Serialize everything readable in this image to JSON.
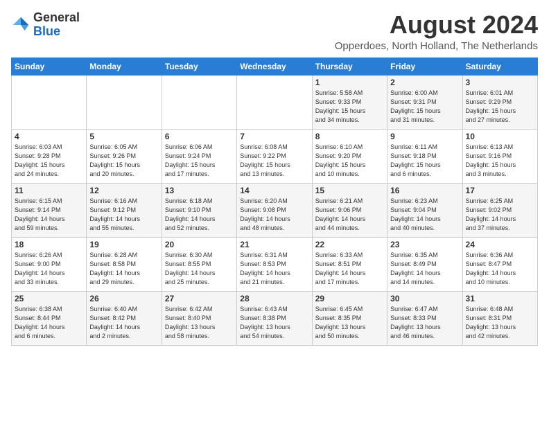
{
  "logo": {
    "general": "General",
    "blue": "Blue"
  },
  "header": {
    "month_title": "August 2024",
    "subtitle": "Opperdoes, North Holland, The Netherlands"
  },
  "days_of_week": [
    "Sunday",
    "Monday",
    "Tuesday",
    "Wednesday",
    "Thursday",
    "Friday",
    "Saturday"
  ],
  "weeks": [
    [
      {
        "day": "",
        "info": ""
      },
      {
        "day": "",
        "info": ""
      },
      {
        "day": "",
        "info": ""
      },
      {
        "day": "",
        "info": ""
      },
      {
        "day": "1",
        "info": "Sunrise: 5:58 AM\nSunset: 9:33 PM\nDaylight: 15 hours\nand 34 minutes."
      },
      {
        "day": "2",
        "info": "Sunrise: 6:00 AM\nSunset: 9:31 PM\nDaylight: 15 hours\nand 31 minutes."
      },
      {
        "day": "3",
        "info": "Sunrise: 6:01 AM\nSunset: 9:29 PM\nDaylight: 15 hours\nand 27 minutes."
      }
    ],
    [
      {
        "day": "4",
        "info": "Sunrise: 6:03 AM\nSunset: 9:28 PM\nDaylight: 15 hours\nand 24 minutes."
      },
      {
        "day": "5",
        "info": "Sunrise: 6:05 AM\nSunset: 9:26 PM\nDaylight: 15 hours\nand 20 minutes."
      },
      {
        "day": "6",
        "info": "Sunrise: 6:06 AM\nSunset: 9:24 PM\nDaylight: 15 hours\nand 17 minutes."
      },
      {
        "day": "7",
        "info": "Sunrise: 6:08 AM\nSunset: 9:22 PM\nDaylight: 15 hours\nand 13 minutes."
      },
      {
        "day": "8",
        "info": "Sunrise: 6:10 AM\nSunset: 9:20 PM\nDaylight: 15 hours\nand 10 minutes."
      },
      {
        "day": "9",
        "info": "Sunrise: 6:11 AM\nSunset: 9:18 PM\nDaylight: 15 hours\nand 6 minutes."
      },
      {
        "day": "10",
        "info": "Sunrise: 6:13 AM\nSunset: 9:16 PM\nDaylight: 15 hours\nand 3 minutes."
      }
    ],
    [
      {
        "day": "11",
        "info": "Sunrise: 6:15 AM\nSunset: 9:14 PM\nDaylight: 14 hours\nand 59 minutes."
      },
      {
        "day": "12",
        "info": "Sunrise: 6:16 AM\nSunset: 9:12 PM\nDaylight: 14 hours\nand 55 minutes."
      },
      {
        "day": "13",
        "info": "Sunrise: 6:18 AM\nSunset: 9:10 PM\nDaylight: 14 hours\nand 52 minutes."
      },
      {
        "day": "14",
        "info": "Sunrise: 6:20 AM\nSunset: 9:08 PM\nDaylight: 14 hours\nand 48 minutes."
      },
      {
        "day": "15",
        "info": "Sunrise: 6:21 AM\nSunset: 9:06 PM\nDaylight: 14 hours\nand 44 minutes."
      },
      {
        "day": "16",
        "info": "Sunrise: 6:23 AM\nSunset: 9:04 PM\nDaylight: 14 hours\nand 40 minutes."
      },
      {
        "day": "17",
        "info": "Sunrise: 6:25 AM\nSunset: 9:02 PM\nDaylight: 14 hours\nand 37 minutes."
      }
    ],
    [
      {
        "day": "18",
        "info": "Sunrise: 6:26 AM\nSunset: 9:00 PM\nDaylight: 14 hours\nand 33 minutes."
      },
      {
        "day": "19",
        "info": "Sunrise: 6:28 AM\nSunset: 8:58 PM\nDaylight: 14 hours\nand 29 minutes."
      },
      {
        "day": "20",
        "info": "Sunrise: 6:30 AM\nSunset: 8:55 PM\nDaylight: 14 hours\nand 25 minutes."
      },
      {
        "day": "21",
        "info": "Sunrise: 6:31 AM\nSunset: 8:53 PM\nDaylight: 14 hours\nand 21 minutes."
      },
      {
        "day": "22",
        "info": "Sunrise: 6:33 AM\nSunset: 8:51 PM\nDaylight: 14 hours\nand 17 minutes."
      },
      {
        "day": "23",
        "info": "Sunrise: 6:35 AM\nSunset: 8:49 PM\nDaylight: 14 hours\nand 14 minutes."
      },
      {
        "day": "24",
        "info": "Sunrise: 6:36 AM\nSunset: 8:47 PM\nDaylight: 14 hours\nand 10 minutes."
      }
    ],
    [
      {
        "day": "25",
        "info": "Sunrise: 6:38 AM\nSunset: 8:44 PM\nDaylight: 14 hours\nand 6 minutes."
      },
      {
        "day": "26",
        "info": "Sunrise: 6:40 AM\nSunset: 8:42 PM\nDaylight: 14 hours\nand 2 minutes."
      },
      {
        "day": "27",
        "info": "Sunrise: 6:42 AM\nSunset: 8:40 PM\nDaylight: 13 hours\nand 58 minutes."
      },
      {
        "day": "28",
        "info": "Sunrise: 6:43 AM\nSunset: 8:38 PM\nDaylight: 13 hours\nand 54 minutes."
      },
      {
        "day": "29",
        "info": "Sunrise: 6:45 AM\nSunset: 8:35 PM\nDaylight: 13 hours\nand 50 minutes."
      },
      {
        "day": "30",
        "info": "Sunrise: 6:47 AM\nSunset: 8:33 PM\nDaylight: 13 hours\nand 46 minutes."
      },
      {
        "day": "31",
        "info": "Sunrise: 6:48 AM\nSunset: 8:31 PM\nDaylight: 13 hours\nand 42 minutes."
      }
    ]
  ]
}
